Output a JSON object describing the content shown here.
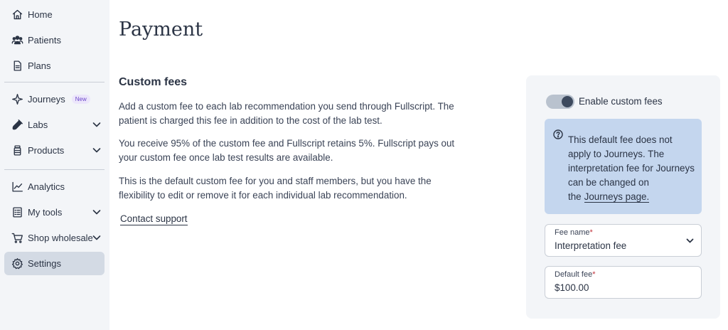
{
  "sidebar": {
    "items": [
      {
        "label": "Home",
        "icon": "home-icon"
      },
      {
        "label": "Patients",
        "icon": "patients-icon"
      },
      {
        "label": "Plans",
        "icon": "plans-icon"
      },
      {
        "label": "Journeys",
        "icon": "journeys-icon",
        "badge": "New"
      },
      {
        "label": "Labs",
        "icon": "labs-icon"
      },
      {
        "label": "Products",
        "icon": "products-icon"
      },
      {
        "label": "Analytics",
        "icon": "analytics-icon"
      },
      {
        "label": "My tools",
        "icon": "tools-icon"
      },
      {
        "label": "Shop wholesale",
        "icon": "cart-icon"
      },
      {
        "label": "Settings",
        "icon": "gear-icon",
        "active": true
      }
    ]
  },
  "main": {
    "title": "Payment",
    "section_title": "Custom fees",
    "paragraphs": [
      "Add a custom fee to each lab recommendation you send through Fullscript. The patient is charged this fee in addition to the cost of the lab test.",
      "You receive 95% of the custom fee and Fullscript retains 5%. Fullscript pays out your custom fee once lab test results are available.",
      "This is the default custom fee for you and staff members, but you have the flexibility to edit or remove it for each individual lab recommendation."
    ],
    "contact_link": "Contact support"
  },
  "panel": {
    "toggle_label": "Enable custom fees",
    "toggle_on": true,
    "info_text": "This default fee does not apply to Journeys. The interpretation fee for Journeys can be changed on the",
    "info_link": "Journeys page.",
    "fee_name_label": "Fee name",
    "fee_name_value": "Interpretation fee",
    "default_fee_label": "Default fee",
    "default_fee_value": "$100.00",
    "required_mark": "*"
  },
  "colors": {
    "sidebar_bg": "#f3f5f8",
    "active_bg": "#d3dae4",
    "info_bg": "#c4d6ee",
    "badge_text": "#6a44c9",
    "required": "#c0313a"
  }
}
